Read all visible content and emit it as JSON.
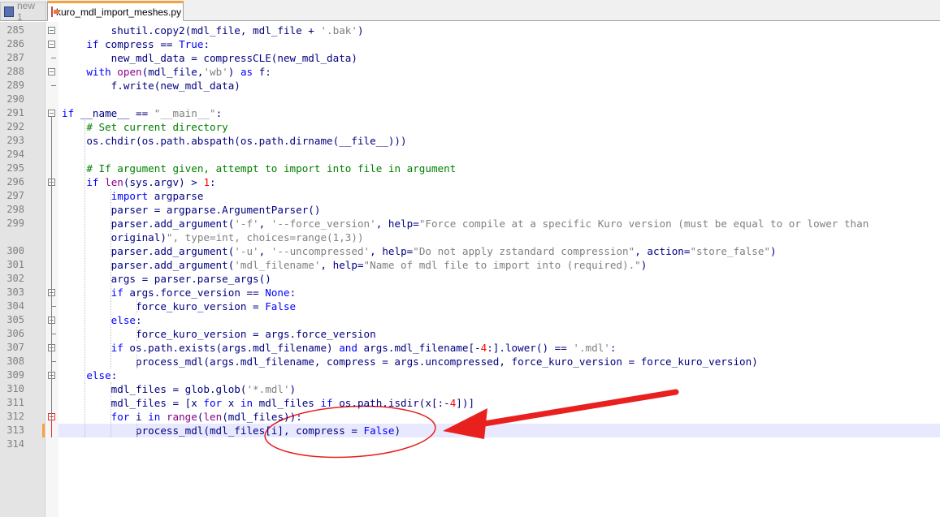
{
  "tabs": [
    {
      "label": "new 1",
      "active": false,
      "icon": "floppy-icon"
    },
    {
      "label": "kuro_mdl_import_meshes.py",
      "active": true,
      "icon": "python-file-icon"
    }
  ],
  "lines": [
    {
      "n": "285",
      "text": "        shutil.copy2(mdl_file, mdl_file + '.bak')"
    },
    {
      "n": "286",
      "text": "    if compress == True:"
    },
    {
      "n": "287",
      "text": "        new_mdl_data = compressCLE(new_mdl_data)"
    },
    {
      "n": "288",
      "text": "    with open(mdl_file,'wb') as f:"
    },
    {
      "n": "289",
      "text": "        f.write(new_mdl_data)"
    },
    {
      "n": "290",
      "text": ""
    },
    {
      "n": "291",
      "text": "if __name__ == \"__main__\":"
    },
    {
      "n": "292",
      "text": "    # Set current directory"
    },
    {
      "n": "293",
      "text": "    os.chdir(os.path.abspath(os.path.dirname(__file__)))"
    },
    {
      "n": "294",
      "text": ""
    },
    {
      "n": "295",
      "text": "    # If argument given, attempt to import into file in argument"
    },
    {
      "n": "296",
      "text": "    if len(sys.argv) > 1:"
    },
    {
      "n": "297",
      "text": "        import argparse"
    },
    {
      "n": "298",
      "text": "        parser = argparse.ArgumentParser()"
    },
    {
      "n": "299",
      "text": "        parser.add_argument('-f', '--force_version', help=\"Force compile at a specific Kuro version (must be equal to or lower than"
    },
    {
      "n": "",
      "text": "        original)\", type=int, choices=range(1,3))"
    },
    {
      "n": "300",
      "text": "        parser.add_argument('-u', '--uncompressed', help=\"Do not apply zstandard compression\", action=\"store_false\")"
    },
    {
      "n": "301",
      "text": "        parser.add_argument('mdl_filename', help=\"Name of mdl file to import into (required).\")"
    },
    {
      "n": "302",
      "text": "        args = parser.parse_args()"
    },
    {
      "n": "303",
      "text": "        if args.force_version == None:"
    },
    {
      "n": "304",
      "text": "            force_kuro_version = False"
    },
    {
      "n": "305",
      "text": "        else:"
    },
    {
      "n": "306",
      "text": "            force_kuro_version = args.force_version"
    },
    {
      "n": "307",
      "text": "        if os.path.exists(args.mdl_filename) and args.mdl_filename[-4:].lower() == '.mdl':"
    },
    {
      "n": "308",
      "text": "            process_mdl(args.mdl_filename, compress = args.uncompressed, force_kuro_version = force_kuro_version)"
    },
    {
      "n": "309",
      "text": "    else:"
    },
    {
      "n": "310",
      "text": "        mdl_files = glob.glob('*.mdl')"
    },
    {
      "n": "311",
      "text": "        mdl_files = [x for x in mdl_files if os.path.isdir(x[:-4])]"
    },
    {
      "n": "312",
      "text": "        for i in range(len(mdl_files)):"
    },
    {
      "n": "313",
      "text": "            process_mdl(mdl_files[i], compress = False)"
    },
    {
      "n": "314",
      "text": ""
    }
  ],
  "colors": {
    "keyword": "#0000ff",
    "builtin": "#880088",
    "string": "#808080",
    "number": "#ff0000",
    "comment": "#008000",
    "annotation": "#e8201e",
    "current_line": "#e8e8ff"
  }
}
